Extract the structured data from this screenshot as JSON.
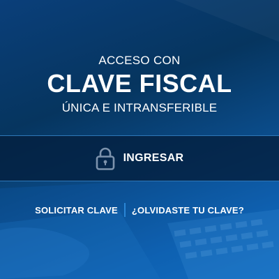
{
  "heading": {
    "pre": "ACCESO CON",
    "title": "CLAVE FISCAL",
    "sub": "ÚNICA E INTRANSFERIBLE"
  },
  "login": {
    "label": "INGRESAR",
    "icon": "lock-icon"
  },
  "links": {
    "request": "SOLICITAR CLAVE",
    "forgot": "¿OLVIDASTE TU CLAVE?"
  },
  "colors": {
    "background": "#0a3f7a",
    "login_bar": "#042040",
    "separator": "#2a86d6",
    "text": "#ffffff"
  }
}
